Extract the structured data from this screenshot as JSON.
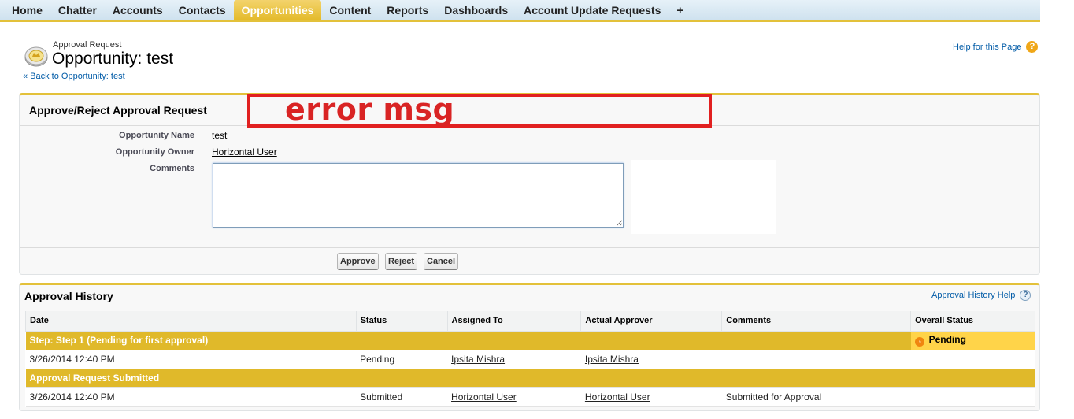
{
  "tabs": [
    {
      "label": "Home"
    },
    {
      "label": "Chatter"
    },
    {
      "label": "Accounts"
    },
    {
      "label": "Contacts"
    },
    {
      "label": "Opportunities"
    },
    {
      "label": "Content"
    },
    {
      "label": "Reports"
    },
    {
      "label": "Dashboards"
    },
    {
      "label": "Account Update Requests"
    },
    {
      "label": "+"
    }
  ],
  "active_tab": "Opportunities",
  "header": {
    "subtitle": "Approval Request",
    "title": "Opportunity: test",
    "back_link": "« Back to Opportunity: test",
    "help_link": "Help for this Page",
    "help_icon": "?"
  },
  "approve_panel": {
    "title": "Approve/Reject Approval Request",
    "fields": {
      "opportunity_name_label": "Opportunity Name",
      "opportunity_name_value": "test",
      "opportunity_owner_label": "Opportunity Owner",
      "opportunity_owner_value": "Horizontal User",
      "comments_label": "Comments"
    },
    "comments_value": "",
    "buttons": {
      "approve": "Approve",
      "reject": "Reject",
      "cancel": "Cancel"
    }
  },
  "annotation": {
    "error_text": "error msg",
    "color": "#e12020"
  },
  "history": {
    "title": "Approval History",
    "help_link": "Approval History Help",
    "help_icon": "?",
    "columns": [
      "Date",
      "Status",
      "Assigned To",
      "Actual Approver",
      "Comments",
      "Overall Status"
    ],
    "step1": {
      "label": "Step: Step 1 (Pending for first approval)",
      "overall_status": "Pending"
    },
    "row1": {
      "date": "3/26/2014 12:40 PM",
      "status": "Pending",
      "assigned_to": "Ipsita Mishra",
      "actual_approver": "Ipsita Mishra",
      "comments": ""
    },
    "step2": {
      "label": "Approval Request Submitted"
    },
    "row2": {
      "date": "3/26/2014 12:40 PM",
      "status": "Submitted",
      "assigned_to": "Horizontal User",
      "actual_approver": "Horizontal User",
      "comments": "Submitted for Approval"
    }
  },
  "colors": {
    "accent_gold": "#e3c13a",
    "step_row": "#e0b92a",
    "pending": "#ffd449",
    "link": "#015ba7"
  }
}
